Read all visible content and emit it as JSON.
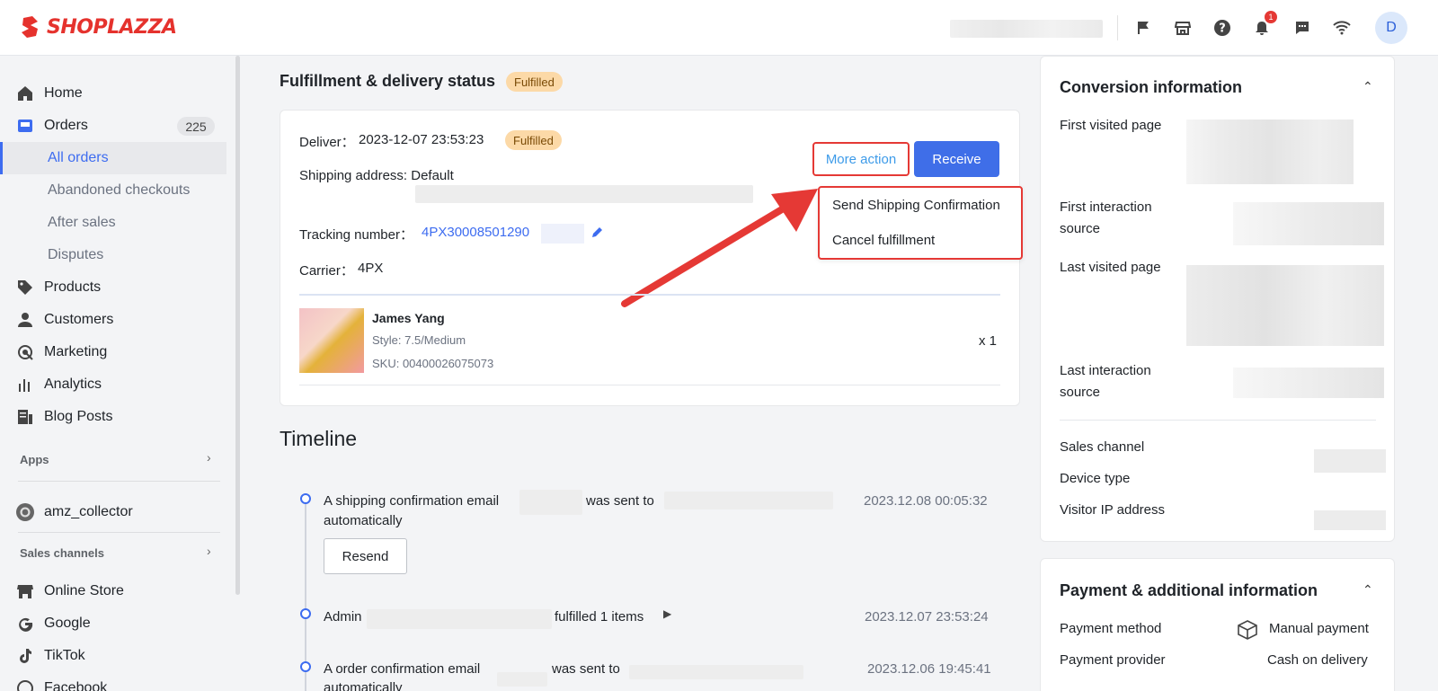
{
  "brand": {
    "name": "SHOPLAZZA",
    "color": "#e5322d"
  },
  "topbar": {
    "icons": [
      "flag-icon",
      "store-icon",
      "help-icon",
      "bell-icon",
      "chat-icon",
      "wifi-icon"
    ],
    "notification_count": "1",
    "avatar_initial": "D"
  },
  "sidebar": {
    "home": "Home",
    "orders": "Orders",
    "orders_count": "225",
    "all_orders": "All orders",
    "abandoned": "Abandoned checkouts",
    "after_sales": "After sales",
    "disputes": "Disputes",
    "products": "Products",
    "customers": "Customers",
    "marketing": "Marketing",
    "analytics": "Analytics",
    "blog_posts": "Blog Posts",
    "apps_label": "Apps",
    "app_item": "amz_collector",
    "sales_channels_label": "Sales channels",
    "online_store": "Online Store",
    "google": "Google",
    "tiktok": "TikTok",
    "facebook": "Facebook"
  },
  "fulfillment": {
    "title": "Fulfillment & delivery status",
    "status_tag": "Fulfilled",
    "deliver_label": "Deliver：",
    "deliver_time": "2023-12-07 23:53:23",
    "deliver_tag": "Fulfilled",
    "shipping_address": "Shipping address: Default",
    "tracking_label": "Tracking number：",
    "tracking_number": "4PX30008501290",
    "carrier_label": "Carrier：",
    "carrier": "4PX",
    "more_action": "More action",
    "receive": "Receive",
    "dropdown": [
      "Send Shipping Confirmation",
      "Cancel fulfillment"
    ],
    "product": {
      "name": "James Yang",
      "style": "Style: 7.5/Medium",
      "sku": "SKU: 00400026075073",
      "qty": "x 1"
    }
  },
  "timeline": {
    "title": "Timeline",
    "events": [
      {
        "text_a": "A shipping confirmation email",
        "text_b": "was sent to",
        "text_c": "automatically",
        "time": "2023.12.08 00:05:32"
      },
      {
        "text_a": "Admin",
        "text_b": "fulfilled 1 items",
        "time": "2023.12.07 23:53:24"
      },
      {
        "text_a": "A order confirmation email",
        "text_b": "was sent to",
        "text_c": "automatically",
        "time": "2023.12.06 19:45:41"
      }
    ],
    "resend": "Resend"
  },
  "conversion": {
    "title": "Conversion information",
    "first_visited": "First visited page",
    "first_interaction": "First interaction source",
    "last_visited": "Last visited page",
    "last_interaction": "Last interaction source",
    "sales_channel": "Sales channel",
    "device_type": "Device type",
    "visitor_ip": "Visitor IP address"
  },
  "payment": {
    "title": "Payment & additional information",
    "method_label": "Payment method",
    "method_value": "Manual payment",
    "provider_label": "Payment provider",
    "provider_value": "Cash on delivery"
  },
  "colors": {
    "accent": "#3d6cf0",
    "annotation_red": "#e53935",
    "tag_bg": "#fcd9a7"
  }
}
